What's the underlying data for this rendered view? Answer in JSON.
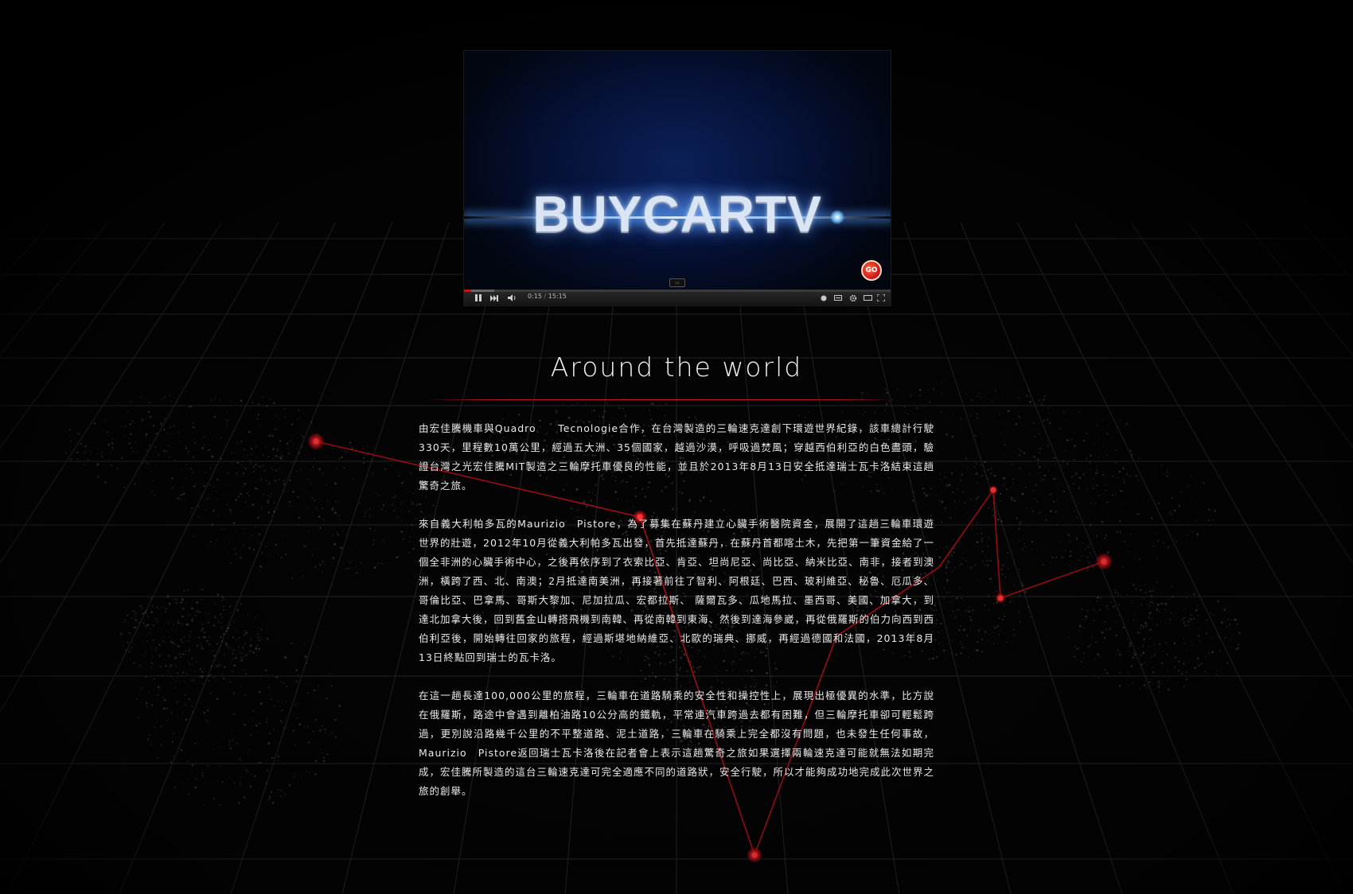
{
  "colors": {
    "background": "#040404",
    "accent_red": "#d01820",
    "route_line": "#c8101a",
    "text": "#eaeaea"
  },
  "video": {
    "logo_text": "BUYCARTV",
    "time_current": "0:15",
    "time_separator": "/",
    "time_total": "15:15",
    "progress_fraction": 0.016,
    "buffered_fraction": 0.07,
    "channel_badge": "GO",
    "controls": {
      "play_pause_icon": "pause-icon",
      "next_icon": "next-icon",
      "volume_icon": "volume-icon",
      "info_icon": "info-icon",
      "captions_icon": "captions-icon",
      "settings_icon": "gear-icon",
      "theater_icon": "theater-mode-icon",
      "fullscreen_icon": "fullscreen-icon"
    }
  },
  "section": {
    "title": "Around the world"
  },
  "article": {
    "paragraphs": [
      "由宏佳騰機車與Quadro　　Tecnologie合作，在台灣製造的三輪速克達創下環遊世界紀錄，該車總計行駛330天，里程數10萬公里，經過五大洲、35個國家，越過沙漠，呼吸過焚風；穿越西伯利亞的白色盡頭，驗證台灣之光宏佳騰MIT製造之三輪摩托車優良的性能，並且於2013年8月13日安全抵達瑞士瓦卡洛結束這趟驚奇之旅。",
      "來自義大利帕多瓦的Maurizio　Pistore，為了募集在蘇丹建立心臟手術醫院資金，展開了這趟三輪車環遊世界的壯遊，2012年10月從義大利帕多瓦出發，首先抵達蘇丹，在蘇丹首都喀土木，先把第一筆資金給了一個全非洲的心臟手術中心，之後再依序到了衣索比亞、肯亞、坦尚尼亞、尚比亞、納米比亞、南非，接者到澳洲，橫跨了西、北、南澳；2月抵達南美洲，再接著前往了智利、阿根廷、巴西、玻利維亞、秘魯、厄瓜多、哥倫比亞、巴拿馬、哥斯大黎加、尼加拉瓜、宏都拉斯、 薩爾瓦多、瓜地馬拉、墨西哥、美國、加拿大，到達北加拿大後，回到舊金山轉搭飛機到南韓、再從南韓到東海、然後到達海參崴，再從俄羅斯的伯力向西到西伯利亞後，開始轉往回家的旅程，經過斯堪地納維亞、北歐的瑞典、挪威，再經過德國和法國，2013年8月13日終點回到瑞士的瓦卡洛。",
      "在這一趟長達100,000公里的旅程，三輪車在道路騎乘的安全性和操控性上，展現出極優異的水準，比方說在俄羅斯，路途中會遇到離柏油路10公分高的鐵軌，平常連汽車跨過去都有困難，但三輪摩托車卻可輕鬆跨過，更別說沿路幾千公里的不平整道路、泥土道路，三輪車在騎乘上完全都沒有問題，也未發生任何事故，Maurizio　Pistore返回瑞士瓦卡洛後在記者會上表示這趟驚奇之旅如果選擇兩輪速克達可能就無法如期完成，宏佳騰所製造的這台三輪速克達可完全適應不同的道路狀，安全行駛，所以才能夠成功地完成此次世界之旅的創舉。"
    ]
  }
}
